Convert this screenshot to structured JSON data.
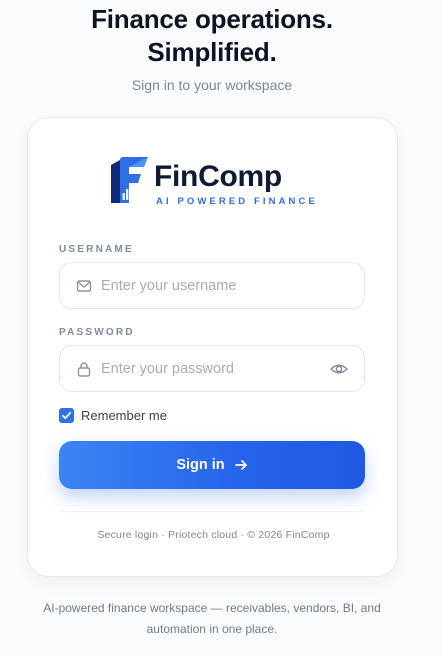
{
  "hero": {
    "headline_line1": "Finance operations.",
    "headline_line2": "Simplified.",
    "subheading": "Sign in to your workspace"
  },
  "brand": {
    "name": "FinComp",
    "tagline": "AI POWERED FINANCE",
    "logo_icon": "fincomp-logo-icon",
    "colors": {
      "primary_dark": "#0e2a78",
      "primary": "#2f6ee5",
      "light": "#4e95f5"
    }
  },
  "form": {
    "username": {
      "label": "USERNAME",
      "placeholder": "Enter your username",
      "value": "",
      "icon": "mail-icon"
    },
    "password": {
      "label": "PASSWORD",
      "placeholder": "Enter your password",
      "value": "",
      "icon": "lock-icon",
      "toggle_icon": "eye-icon"
    },
    "remember_me": {
      "label": "Remember me",
      "checked": true
    },
    "submit": {
      "label": "Sign in",
      "icon": "arrow-right-icon"
    }
  },
  "card_footer": "Secure login · Priotech cloud · © 2026 FinComp",
  "bottom_note": {
    "line1": "AI-powered finance workspace — receivables, vendors, BI, and",
    "line2": "automation in one place."
  },
  "colors": {
    "accent": "#2563eb",
    "heading": "#0c1424",
    "muted": "#7b8797"
  }
}
